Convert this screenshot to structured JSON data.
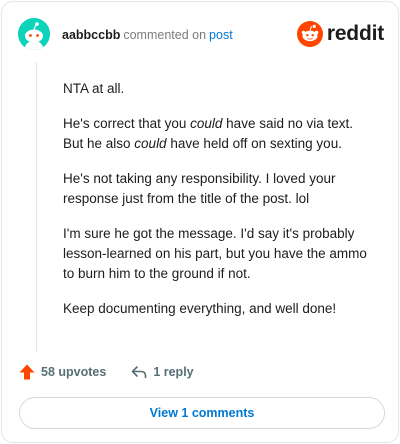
{
  "comment": {
    "author": "aabbccbb",
    "action_text": "commented on",
    "target_link": "post",
    "paragraphs": [
      [
        "NTA at all."
      ],
      [
        "He's correct that you ",
        "could",
        " have said no via text. But he also ",
        "could",
        " have held off on sexting you."
      ],
      [
        "He's not taking any responsibility. I loved your response just from the title of the post. lol"
      ],
      [
        "I'm sure he got the message. I'd say it's probably lesson-learned on his part, but you have the ammo to burn him to the ground if not."
      ],
      [
        "Keep documenting everything, and well done!"
      ]
    ]
  },
  "brand": {
    "wordmark": "reddit",
    "logo_icon": "reddit-snoo-icon",
    "accent": "#ff4500"
  },
  "actions": {
    "upvotes_label": "58 upvotes",
    "upvote_icon": "upvote-arrow-icon",
    "upvote_color": "#ff4500",
    "reply_label": "1 reply",
    "reply_icon": "reply-arrow-icon"
  },
  "view_comments_label": "View 1 comments",
  "avatar": {
    "icon": "snoo-avatar-icon",
    "bg": "#0dd3bb"
  }
}
